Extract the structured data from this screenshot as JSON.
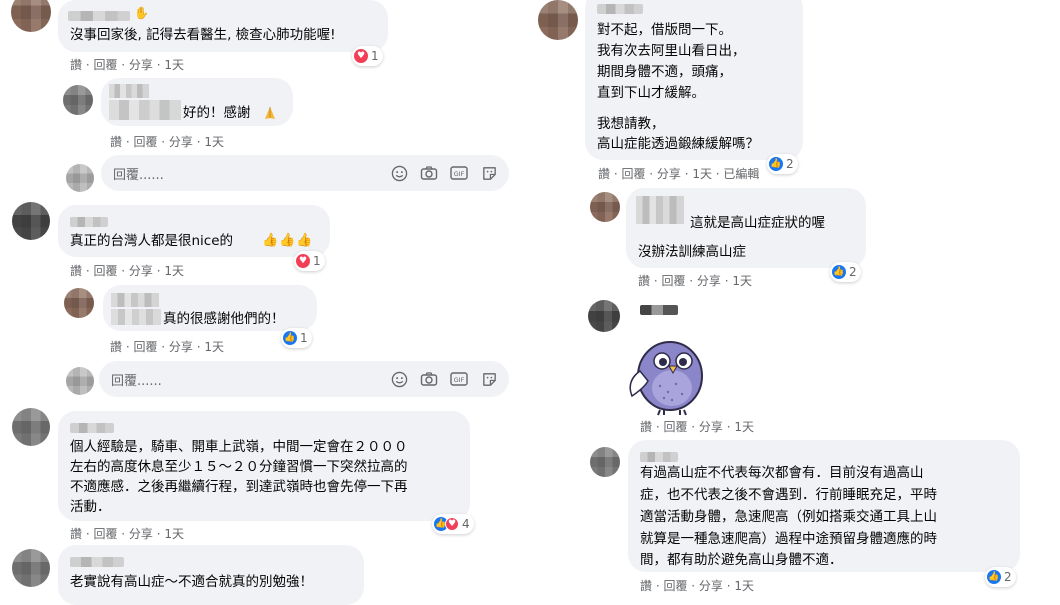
{
  "left": {
    "c1": {
      "text": "沒事回家後, 記得去看醫生, 檢查心肺功能喔!",
      "meta": "讚 · 回覆 · 分享 · 1天",
      "reactions": "1"
    },
    "r1": {
      "text": "好的！感謝",
      "meta": "讚 · 回覆 · 分享 · 1天"
    },
    "reply_box1": {
      "placeholder": "回覆......"
    },
    "c2": {
      "text": "真正的台灣人都是很nice的",
      "meta": "讚 · 回覆 · 分享 · 1天",
      "reactions": "1"
    },
    "r2": {
      "text": "真的很感謝他們的！",
      "meta": "讚 · 回覆 · 分享 · 1天",
      "reactions": "1"
    },
    "reply_box2": {
      "placeholder": "回覆......"
    },
    "c3": {
      "lines": [
        "個人經驗是，騎車、開車上武嶺，中間一定會在２０００",
        "左右的高度休息至少１５～２０分鐘習慣一下突然拉高的",
        "不適應感．之後再繼續行程，到達武嶺時也會先停一下再",
        "活動．"
      ],
      "meta": "讚 · 回覆 · 分享 · 1天",
      "reactions": "4"
    },
    "c4": {
      "text": "老實說有高山症～不適合就真的別勉強！"
    }
  },
  "right": {
    "q": {
      "lines": [
        "對不起，借版問一下。",
        "我有次去阿里山看日出，",
        "期間身體不適，頭痛，",
        "直到下山才緩解。",
        "",
        "我想請教，",
        "高山症能透過鍛練緩解嗎？"
      ],
      "meta": "讚 · 回覆 · 分享 · 1天 · 已編輯",
      "reactions": "2"
    },
    "r1": {
      "line1": "這就是高山症症狀的喔",
      "line2": "沒辦法訓練高山症",
      "meta": "讚 · 回覆 · 分享 · 1天",
      "reactions": "2"
    },
    "r2": {
      "meta": "讚 · 回覆 · 分享 · 1天"
    },
    "r3": {
      "lines": [
        "有過高山症不代表每次都會有．目前沒有過高山",
        "症，也不代表之後不會遇到．行前睡眠充足，平時",
        "適當活動身體，急速爬高（例如搭乘交通工具上山",
        "就算是一種急速爬高）過程中途預留身體適應的時",
        "間，都有助於避免高山身體不適．"
      ],
      "meta": "讚 · 回覆 · 分享 · 1天",
      "reactions": "2"
    }
  },
  "icons": {
    "like": "thumbs-up-icon",
    "heart": "heart-icon",
    "emoji": "smiley-icon",
    "camera": "camera-icon",
    "gif": "gif-icon",
    "sticker": "sticker-icon",
    "wave": "waving-hand-icon",
    "pray": "folded-hands-icon",
    "thumb_emoji": "thumbs-up-emoji-icon"
  }
}
